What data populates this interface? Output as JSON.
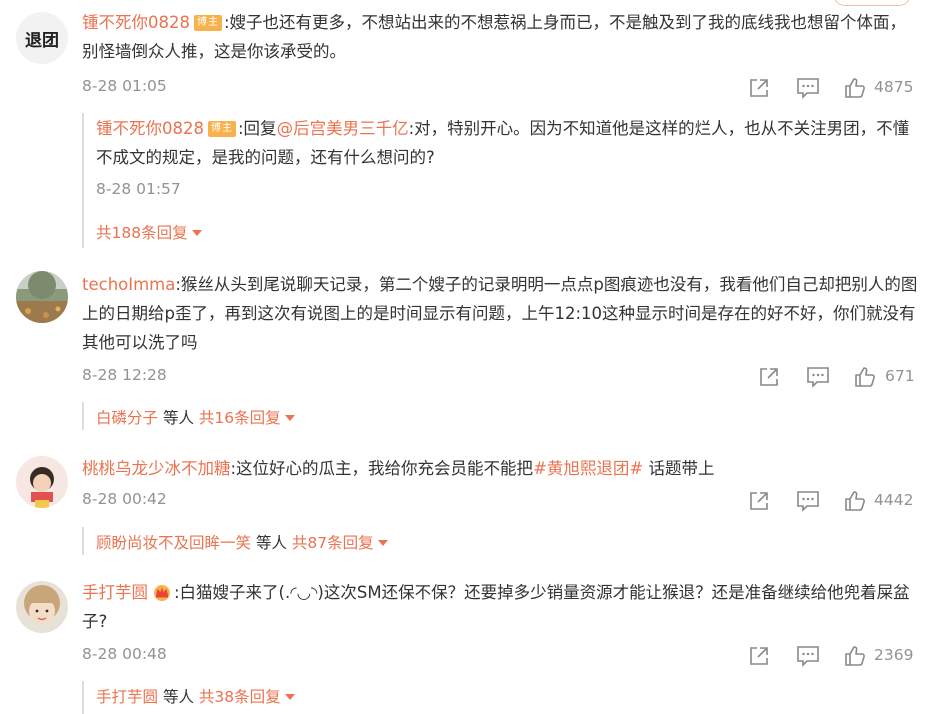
{
  "comments": [
    {
      "username": "锺不死你0828",
      "badge": "博主",
      "text": ":嫂子也还有更多，不想站出来的不想惹祸上身而已，不是触及到了我的底线我也想留个体面，别怪墙倒众人推，这是你该承受的。",
      "time": "8-28 01:05",
      "likes": "4875",
      "avatar_text": "退团",
      "reply": {
        "username": "锺不死你0828",
        "badge": "博主",
        "prefix": ":回复",
        "mention": "@后宫美男三千亿",
        "text": ":对，特别开心。因为不知道他是这样的烂人，也从不关注男团，不懂不成文的规定，是我的问题，还有什么想问的?",
        "time": "8-28 01:57"
      },
      "more": {
        "link": "共188条回复",
        "prefix": ""
      }
    },
    {
      "username": "techoImma",
      "text": ":猴丝从头到尾说聊天记录，第二个嫂子的记录明明一点点p图痕迹也没有，我看他们自己却把别人的图上的日期给p歪了，再到这次有说图上的是时间显示有问题，上午12:10这种显示时间是存在的好不好，你们就没有其他可以洗了吗",
      "time": "8-28 12:28",
      "likes": "671",
      "more": {
        "user": "白磷分子",
        "mid": " 等人 ",
        "link": "共16条回复"
      }
    },
    {
      "username": "桃桃乌龙少冰不加糖",
      "text_before": ":这位好心的瓜主，我给你充会员能不能把",
      "topic": "#黄旭熙退团#",
      "text_after": " 话题带上",
      "time": "8-28 00:42",
      "likes": "4442",
      "more": {
        "user": "顾盼尚妆不及回眸一笑",
        "mid": " 等人 ",
        "link": "共87条回复"
      }
    },
    {
      "username": "手打芋圆",
      "text": ":白猫嫂子来了(.◜◡◝)这次SM还保不保？还要掉多少销量资源才能让猴退？还是准备继续给他兜着屎盆子?",
      "time": "8-28 00:48",
      "likes": "2369",
      "more": {
        "user": "手打芋圆",
        "mid": " 等人 ",
        "link": "共38条回复"
      }
    }
  ],
  "icons": {
    "share": "share-icon",
    "comment": "comment-icon",
    "like": "thumbs-up-icon",
    "expand": "caret-down-icon",
    "crown": "crown-icon"
  },
  "colors": {
    "username": "#eb7350",
    "badge": "#f7b24b",
    "meta": "#939393",
    "text": "#333333"
  }
}
